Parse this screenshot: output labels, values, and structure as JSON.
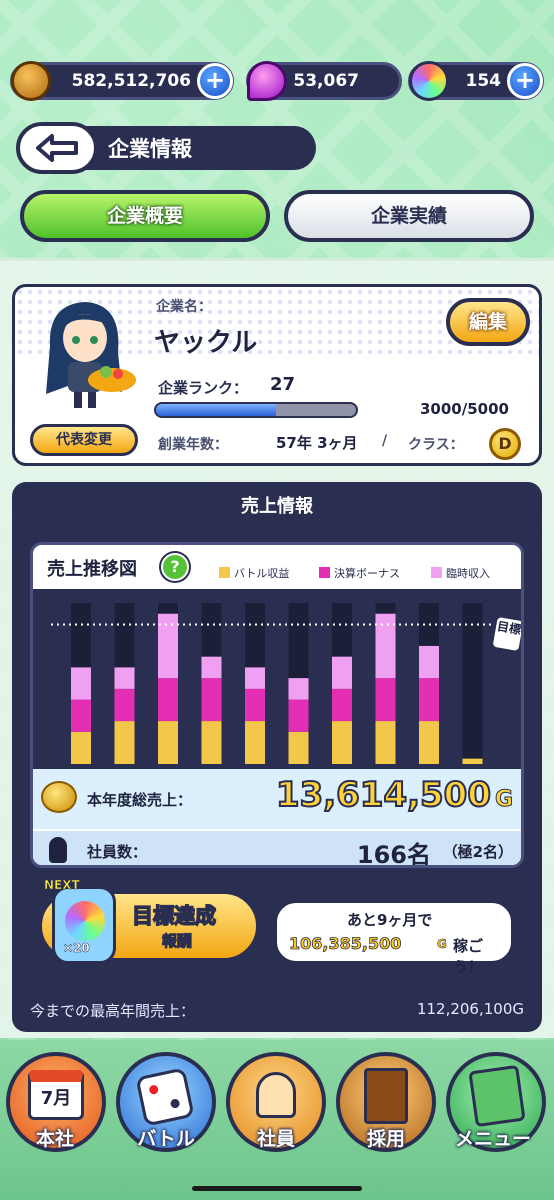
{
  "currency": {
    "coins": "582,512,706",
    "gems": "53,067",
    "orbs": "154"
  },
  "header": {
    "title": "企業情報"
  },
  "tabs": [
    {
      "label": "企業概要",
      "active": true
    },
    {
      "label": "企業実績",
      "active": false
    }
  ],
  "company": {
    "name_label": "企業名：",
    "name": "ヤックル",
    "edit": "編集",
    "rank_label": "企業ランク：",
    "rank": "27",
    "exp": "3000/5000",
    "exp_fraction": 0.6,
    "change_rep": "代表変更",
    "founded_label": "創業年数：",
    "founded": "57年 3ヶ月",
    "sep": "/",
    "class_label": "クラス：",
    "class": "D"
  },
  "sales": {
    "title": "売上情報",
    "chart_title": "売上推移図",
    "help": "?",
    "total_label": "本年度総売上：",
    "total": "13,614,500",
    "total_unit": "G",
    "staff_label": "社員数：",
    "staff": "166名",
    "staff_extra": "（極2名）",
    "goal_tag": "NEXT",
    "goal_count": "×20",
    "goal_title": "目標達成",
    "goal_reward": "報酬",
    "goal_msg1": "あと9ヶ月で",
    "goal_amount": "106,385,500",
    "goal_unit": "G",
    "goal_msg2": "稼ごう！",
    "best_label": "今までの最高年間売上：",
    "best_value": "112,206,100G",
    "target_label": "目標"
  },
  "chart_data": {
    "type": "bar",
    "stacked": true,
    "series": [
      {
        "name": "バトル収益",
        "color": "#f3c84a",
        "values": [
          3,
          4,
          4,
          4,
          4,
          3,
          4,
          4,
          4,
          0.5
        ]
      },
      {
        "name": "決算ボーナス",
        "color": "#e42fb4",
        "values": [
          3,
          3,
          4,
          4,
          3,
          3,
          3,
          4,
          4,
          0
        ]
      },
      {
        "name": "臨時収入",
        "color": "#f0a0f0",
        "values": [
          3,
          2,
          6,
          2,
          2,
          2,
          3,
          6,
          3,
          0
        ]
      }
    ],
    "target": 13,
    "ylim": [
      0,
      15
    ],
    "legend": "top-right"
  },
  "nav": [
    {
      "label": "本社",
      "sub": "7月",
      "icon": "calendar-icon"
    },
    {
      "label": "バトル",
      "icon": "dice-icon"
    },
    {
      "label": "社員",
      "icon": "employee-icon"
    },
    {
      "label": "採用",
      "icon": "door-icon"
    },
    {
      "label": "メニュー",
      "icon": "menu-book-icon"
    }
  ]
}
